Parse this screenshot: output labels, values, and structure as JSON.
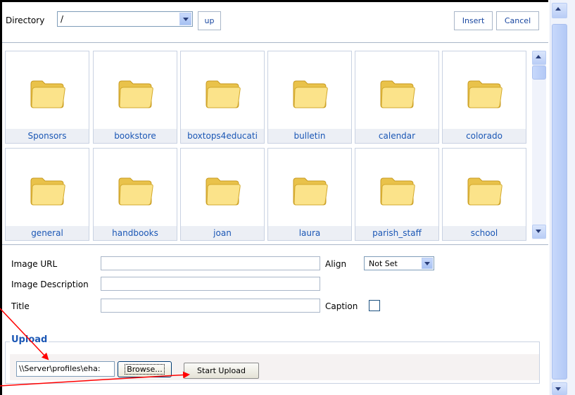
{
  "toolbar": {
    "directory_label": "Directory",
    "directory_value": "/",
    "up_label": "up",
    "insert_label": "Insert",
    "cancel_label": "Cancel"
  },
  "folders": [
    {
      "name": "Sponsors"
    },
    {
      "name": "bookstore"
    },
    {
      "name": "boxtops4educati"
    },
    {
      "name": "bulletin"
    },
    {
      "name": "calendar"
    },
    {
      "name": "colorado"
    },
    {
      "name": "general"
    },
    {
      "name": "handbooks"
    },
    {
      "name": "joan"
    },
    {
      "name": "laura"
    },
    {
      "name": "parish_staff"
    },
    {
      "name": "school"
    }
  ],
  "properties": {
    "image_url_label": "Image URL",
    "image_url_value": "",
    "image_description_label": "Image Description",
    "image_description_value": "",
    "title_label": "Title",
    "title_value": "",
    "align_label": "Align",
    "align_value": "Not Set",
    "caption_label": "Caption",
    "caption_checked": false
  },
  "upload": {
    "legend": "Upload",
    "file_value": "\\\\Server\\profiles\\eha:",
    "browse_label": "Browse...",
    "start_label": "Start Upload"
  },
  "colors": {
    "link_blue": "#1b57b5",
    "annotation_red": "#ff0000",
    "folder_yellow": "#f7d860"
  }
}
